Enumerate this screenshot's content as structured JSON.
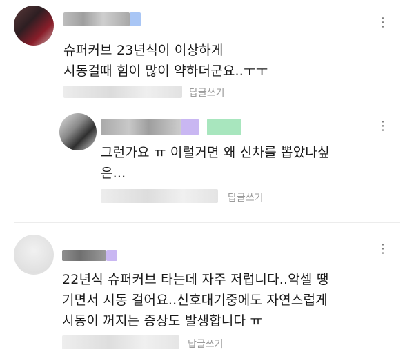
{
  "comments": [
    {
      "lines": [
        "슈퍼커브 23년식이 이상하게",
        "시동걸때 힘이 많이 약하더군요..ㅜㅜ"
      ],
      "reply_label": "답글쓰기",
      "more_label": "⋮",
      "reply": {
        "lines": [
          "그런가요 ㅠ 이럴거면 왜 신차를 뽑았나싶",
          "은..."
        ],
        "reply_label": "답글쓰기",
        "more_label": "⋮"
      }
    },
    {
      "lines": [
        "22년식 슈퍼커브 타는데 자주 저럽니다..악셀 땡",
        "기면서 시동 걸어요..신호대기중에도 자연스럽게",
        "시동이 꺼지는 증상도 발생합니다 ㅠ"
      ],
      "reply_label": "답글쓰기",
      "more_label": "⋮"
    }
  ],
  "colors": {
    "accent_purple": "#c9b7f2",
    "accent_green": "#a8e6be",
    "accent_blue": "#a9c6f5"
  }
}
